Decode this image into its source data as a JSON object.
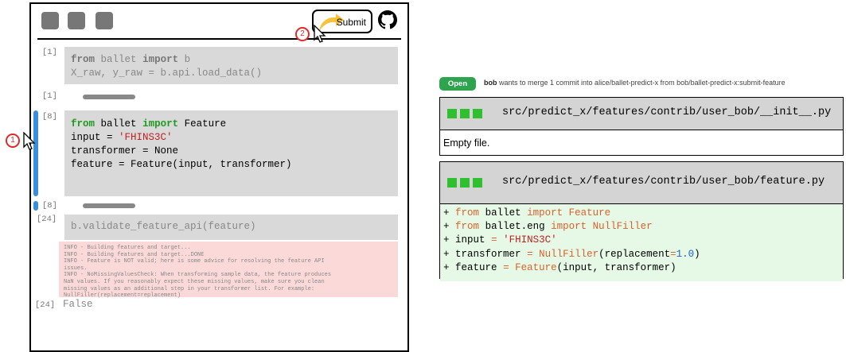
{
  "notebook": {
    "toolbar": {
      "submit_label": "Submit"
    },
    "cells": [
      {
        "prompt": "[1]",
        "code": [
          "b",
          "X_raw, y_raw = b.api.load_data()"
        ]
      },
      {
        "prompt": "[1]"
      },
      {
        "prompt": "[8]",
        "code": [
          "Feature",
          "input = ",
          "'FHINS3C'",
          "transformer = None",
          "feature = Feature(input, transformer)"
        ]
      },
      {
        "prompt": "[8]"
      },
      {
        "prompt": "[24]",
        "code": [
          "b.validate_feature_api(feature)"
        ]
      },
      {
        "prompt": "[24]",
        "output": "False"
      }
    ],
    "keywords": {
      "from": "from",
      "import": "import",
      "ballet": "ballet"
    },
    "log_lines": [
      "INFO - Building features and target...",
      "INFO - Building features and target...DONE",
      "INFO - Feature is NOT valid; here is some advice for resolving the feature API",
      "issues.",
      "INFO - NoMissingValuesCheck: When transforming sample data, the feature produces",
      "NaN values. If you reasonably expect these missing values, make sure you clean",
      "missing values as an additional step in your transformer list. For example:",
      "NullFiller(replacement=replacement)"
    ]
  },
  "annotations": {
    "step1": "1",
    "step2": "2"
  },
  "pull_request": {
    "status": "Open",
    "author": "bob",
    "description": "wants to merge 1 commit into alice/ballet-predict-x from bob/ballet-predict-x:submit-feature",
    "files": [
      {
        "path": "src/predict_x/features/contrib/user_bob/__init__.py",
        "body": "Empty file."
      },
      {
        "path": "src/predict_x/features/contrib/user_bob/feature.py"
      }
    ],
    "diff": {
      "plus": "+",
      "l1": [
        "from",
        "ballet",
        "import",
        "Feature"
      ],
      "l2": [
        "from",
        "ballet.eng",
        "import",
        "NullFiller"
      ],
      "l3": [
        "input",
        "=",
        "'FHINS3C'"
      ],
      "l4": [
        "transformer",
        "=",
        "NullFiller",
        "(replacement",
        "=",
        "1.0",
        ")"
      ],
      "l5": [
        "feature",
        "=",
        "Feature",
        "(input, transformer)"
      ]
    }
  },
  "colors": {
    "accent_blue": "#3b8ed8",
    "open_green": "#2ea44f",
    "error_bg": "#fcd9d9",
    "diff_bg": "#e6f8e6"
  }
}
